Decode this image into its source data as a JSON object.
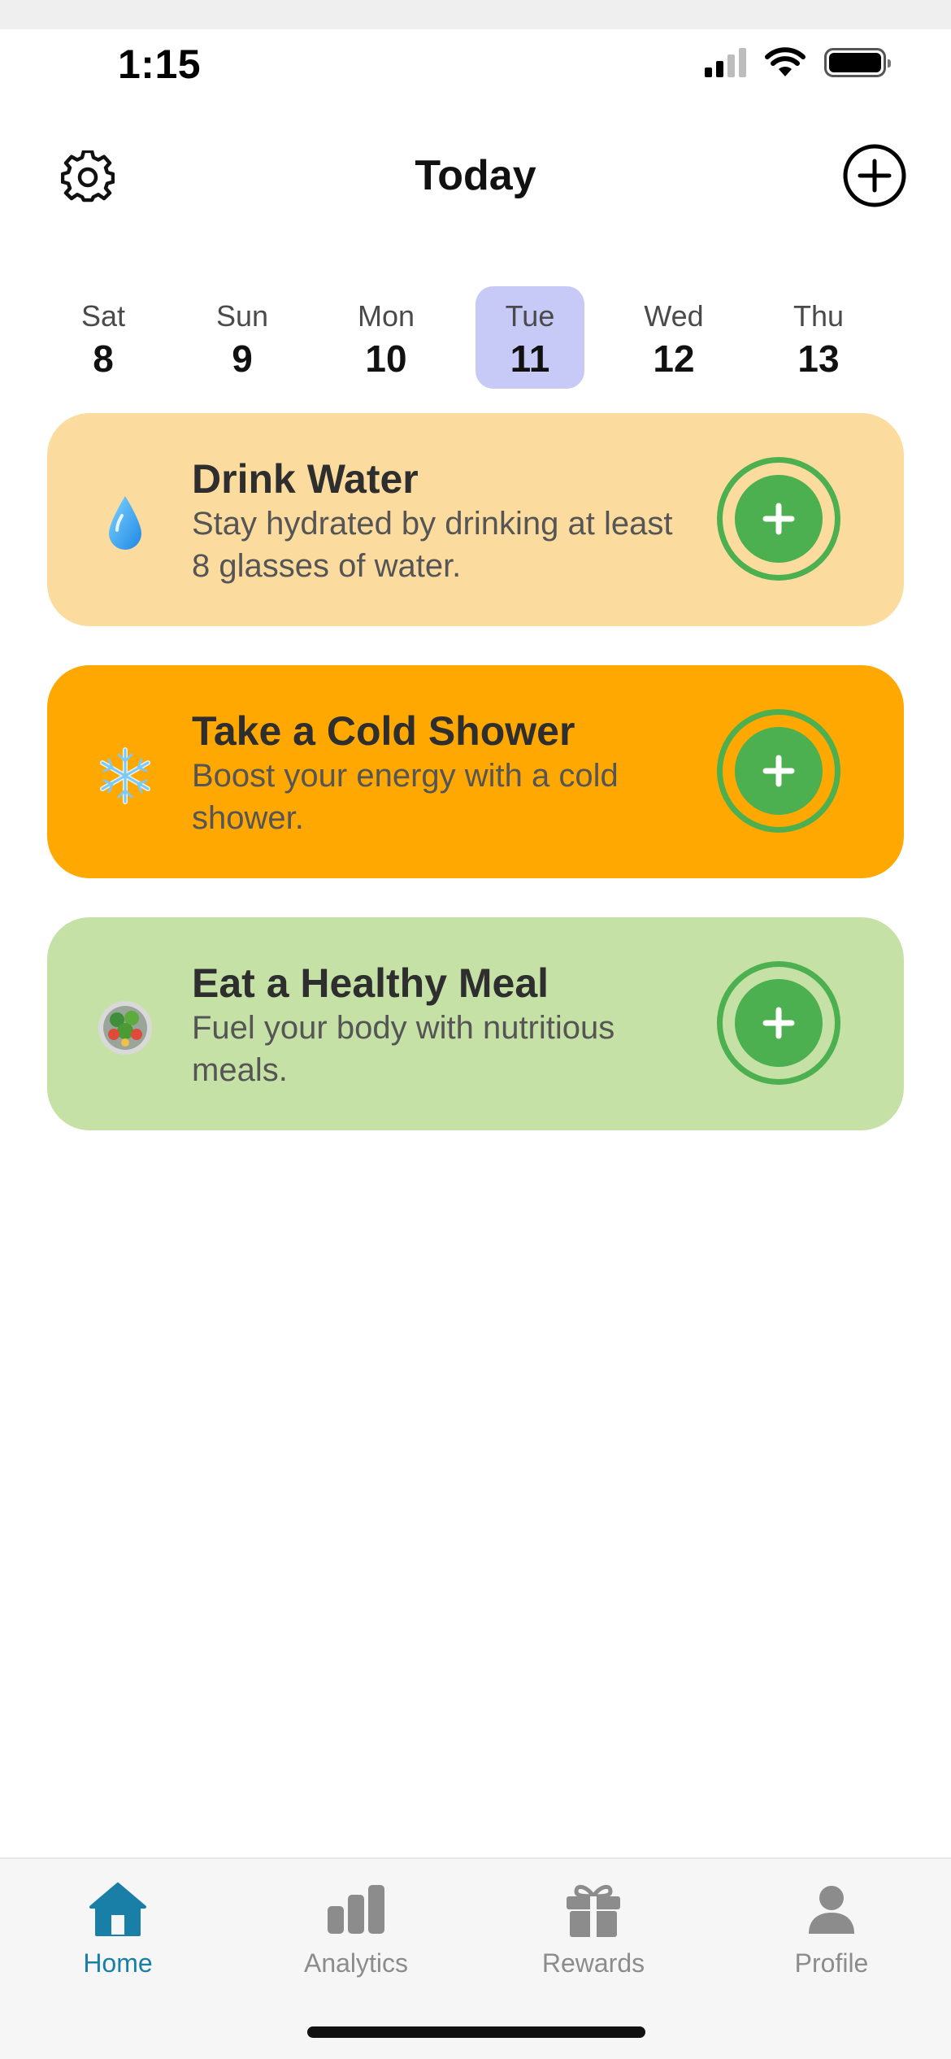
{
  "status_bar": {
    "time": "1:15"
  },
  "header": {
    "title": "Today"
  },
  "dates": [
    {
      "day": "Sat",
      "date": "8",
      "selected": false
    },
    {
      "day": "Sun",
      "date": "9",
      "selected": false
    },
    {
      "day": "Mon",
      "date": "10",
      "selected": false
    },
    {
      "day": "Tue",
      "date": "11",
      "selected": true
    },
    {
      "day": "Wed",
      "date": "12",
      "selected": false
    },
    {
      "day": "Thu",
      "date": "13",
      "selected": false
    }
  ],
  "habits": [
    {
      "title": "Drink Water",
      "description": "Stay hydrated by drinking at least 8 glasses of water.",
      "icon": "water-drop-icon",
      "color": "#fcdc9e"
    },
    {
      "title": "Take a Cold Shower",
      "description": "Boost your energy with a cold shower.",
      "icon": "snowflake-icon",
      "color": "#ffa801"
    },
    {
      "title": "Eat a Healthy Meal",
      "description": "Fuel your body with nutritious meals.",
      "icon": "salad-icon",
      "color": "#c5e1a5"
    }
  ],
  "colors": {
    "accent_green": "#4caf50",
    "selected_day": "#c7c9f7",
    "active_tab": "#1a7fa6",
    "inactive_tab": "#8c8c8c"
  },
  "tabs": [
    {
      "label": "Home",
      "icon": "home-icon",
      "active": true
    },
    {
      "label": "Analytics",
      "icon": "bar-chart-icon",
      "active": false
    },
    {
      "label": "Rewards",
      "icon": "gift-icon",
      "active": false
    },
    {
      "label": "Profile",
      "icon": "person-icon",
      "active": false
    }
  ]
}
